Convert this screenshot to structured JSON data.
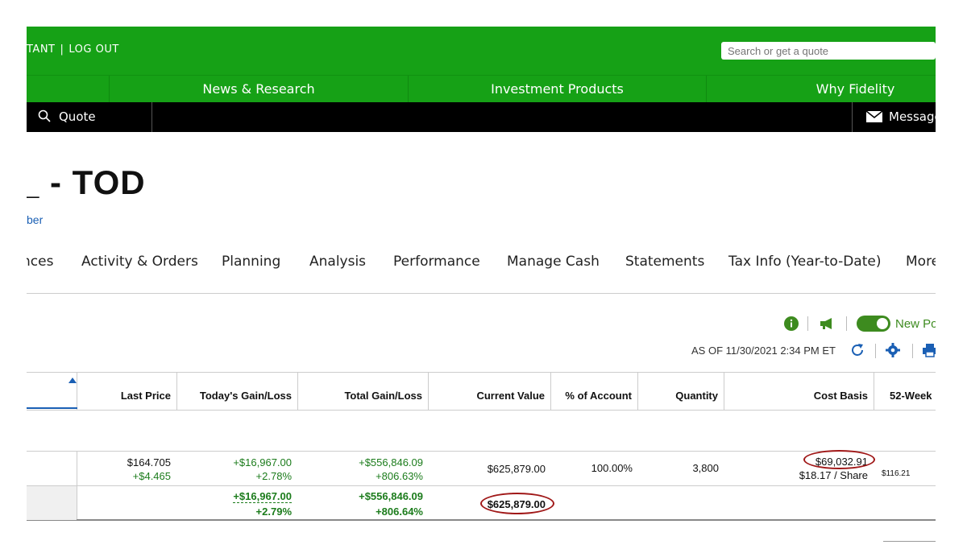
{
  "header": {
    "links": [
      "TANT",
      "LOG OUT"
    ],
    "search_placeholder": "Search or get a quote"
  },
  "nav": {
    "items": [
      "News & Research",
      "Investment Products",
      "Why Fidelity"
    ]
  },
  "blackbar": {
    "quote_label": "Quote",
    "messages_label": "Messages"
  },
  "account": {
    "title": "_ - TOD",
    "sublink": "ber"
  },
  "tabs": [
    "nces",
    "Activity & Orders",
    "Planning",
    "Analysis",
    "Performance",
    "Manage Cash",
    "Statements",
    "Tax Info (Year-to-Date)",
    "More"
  ],
  "controls": {
    "new_positions_label": "New Positions",
    "as_of": "AS OF 11/30/2021 2:34 PM ET",
    "toggle_on": true
  },
  "table": {
    "columns": [
      "",
      "Last Price",
      "Today's Gain/Loss",
      "Total Gain/Loss",
      "Current Value",
      "% of Account",
      "Quantity",
      "Cost Basis",
      "52-Week"
    ],
    "row": {
      "last_price": "$164.705",
      "last_price_change": "+$4.465",
      "today_gain": "+$16,967.00",
      "today_gain_pct": "+2.78%",
      "total_gain": "+$556,846.09",
      "total_gain_pct": "+806.63%",
      "current_value": "$625,879.00",
      "pct_account": "100.00%",
      "quantity": "3,800",
      "cost_basis": "$69,032.91",
      "cost_per_share": "$18.17 / Share",
      "week52": "$116.21"
    },
    "total": {
      "today_gain": "+$16,967.00",
      "today_gain_pct": "+2.79%",
      "total_gain": "+$556,846.09",
      "total_gain_pct": "+806.64%",
      "current_value": "$625,879.00"
    }
  },
  "colors": {
    "brand_green": "#16a116",
    "gain_green": "#1c7c1c",
    "link_blue": "#1a5fb4",
    "highlight_red": "#a01818"
  }
}
